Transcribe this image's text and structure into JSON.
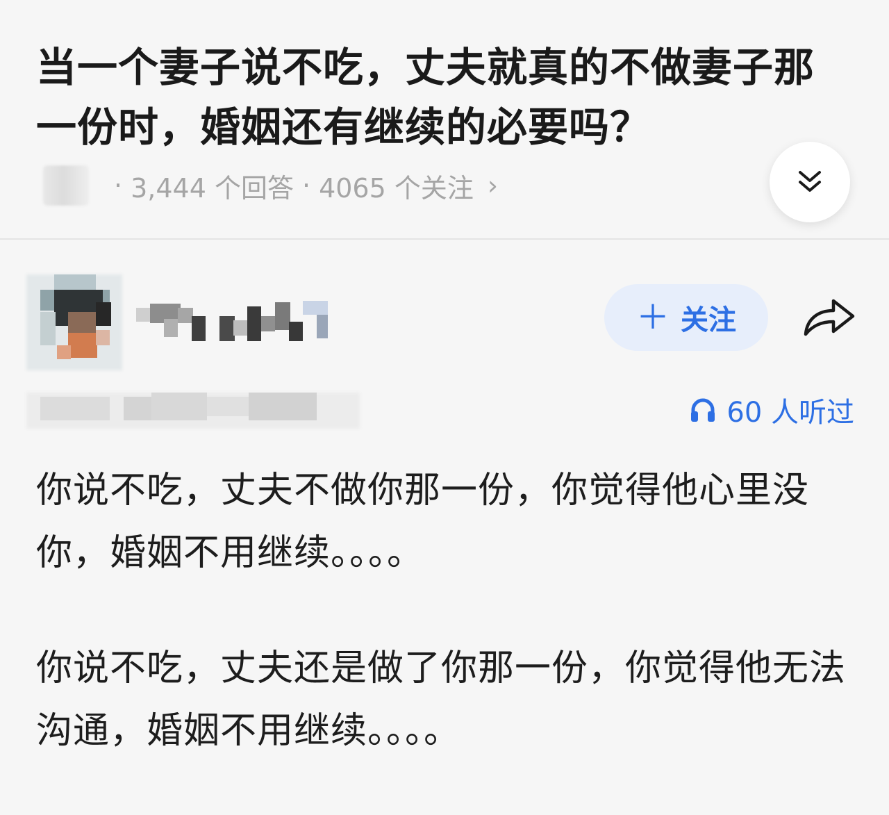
{
  "question": {
    "title": "当一个妻子说不吃，丈夫就真的不做妻子那一份时，婚姻还有继续的必要吗？",
    "answer_count": "3,444 个回答",
    "follower_count": "4065 个关注",
    "separator": "·",
    "chevron": "›"
  },
  "answer": {
    "follow_label": "关注",
    "follow_plus": "＋",
    "listen_count": "60 人听过",
    "paragraphs": [
      "你说不吃，丈夫不做你那一份，你觉得他心里没你，婚姻不用继续。。。。",
      "你说不吃，丈夫还是做了你那一份，你觉得他无法沟通，婚姻不用继续。。。。"
    ]
  },
  "icons": {
    "expand": "double-chevron-down-icon",
    "share": "share-arrow-icon",
    "listen": "headphones-icon"
  },
  "colors": {
    "accent": "#2d6fe4",
    "follow_bg": "#e7eefb",
    "meta_text": "#a5a5a5",
    "background": "#f6f6f6"
  }
}
